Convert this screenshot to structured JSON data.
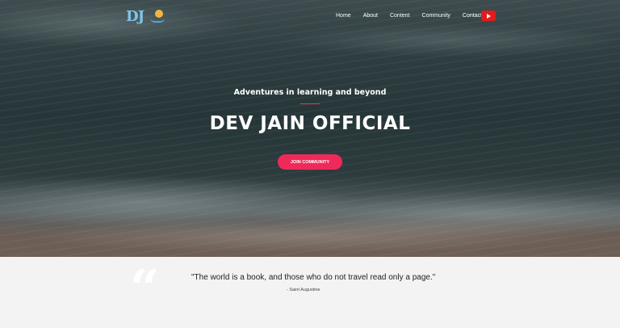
{
  "header": {
    "logo_text": "DJ",
    "nav": [
      "Home",
      "About",
      "Content",
      "Community",
      "Contact"
    ],
    "youtube_icon": "youtube-icon"
  },
  "hero": {
    "tagline": "Adventures in learning and beyond",
    "title": "DEV JAIN OFFICIAL",
    "cta_label": "JOIN COMMUNITY"
  },
  "quote": {
    "mark": "“",
    "text": "\"The world is a book, and those who do not travel read only a page.\"",
    "author": "- Saint Augustine"
  },
  "colors": {
    "accent": "#ef2a5b",
    "youtube": "#e31b1b"
  }
}
